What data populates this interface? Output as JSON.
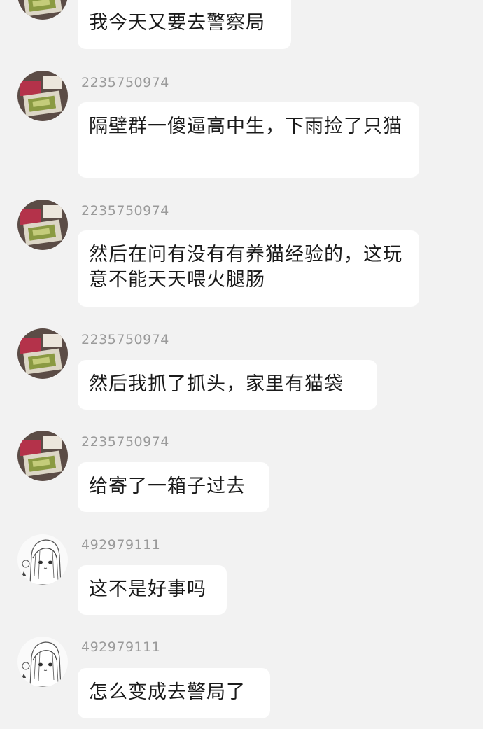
{
  "messages": [
    {
      "sender": "",
      "text": "我今天又要去警察局",
      "avatar": "product-photo-avatar"
    },
    {
      "sender": "2235750974",
      "text": "隔壁群一傻逼高中生，下雨捡了只猫",
      "avatar": "product-photo-avatar"
    },
    {
      "sender": "2235750974",
      "text": "然后在问有没有有养猫经验的，这玩意不能天天喂火腿肠",
      "avatar": "product-photo-avatar"
    },
    {
      "sender": "2235750974",
      "text": "然后我抓了抓头，家里有猫袋",
      "avatar": "product-photo-avatar"
    },
    {
      "sender": "2235750974",
      "text": "给寄了一箱子过去",
      "avatar": "product-photo-avatar"
    },
    {
      "sender": "492979111",
      "text": "这不是好事吗",
      "avatar": "anime-girl-sketch-avatar"
    },
    {
      "sender": "492979111",
      "text": "怎么变成去警局了",
      "avatar": "anime-girl-sketch-avatar"
    }
  ],
  "colors": {
    "background": "#f2f2f2",
    "bubble": "#ffffff",
    "sender_text": "#9a9a9a",
    "message_text": "#1a1a1a"
  }
}
